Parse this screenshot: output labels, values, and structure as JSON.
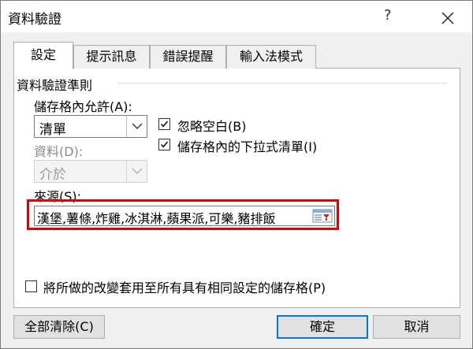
{
  "window": {
    "title": "資料驗證",
    "help": "?"
  },
  "tabs": [
    {
      "label": "設定",
      "active": true
    },
    {
      "label": "提示訊息",
      "active": false
    },
    {
      "label": "錯誤提醒",
      "active": false
    },
    {
      "label": "輸入法模式",
      "active": false
    }
  ],
  "settings": {
    "group_title": "資料驗證準則",
    "allow_label": "儲存格內允許(A):",
    "allow_value": "清單",
    "data_label": "資料(D):",
    "data_value": "介於",
    "ignore_blank_label": "忽略空白(B)",
    "ignore_blank_checked": true,
    "incell_dropdown_label": "儲存格內的下拉式清單(I)",
    "incell_dropdown_checked": true,
    "source_label": "來源(S):",
    "source_value": "漢堡,薯條,炸雞,冰淇淋,蘋果派,可樂,豬排飯",
    "apply_all_label": "將所做的改變套用至所有具有相同設定的儲存格(P)",
    "apply_all_checked": false
  },
  "buttons": {
    "clear_all": "全部清除(C)",
    "ok": "確定",
    "cancel": "取消"
  },
  "colors": {
    "highlight": "#e00000",
    "default_button_border": "#0078d7"
  }
}
